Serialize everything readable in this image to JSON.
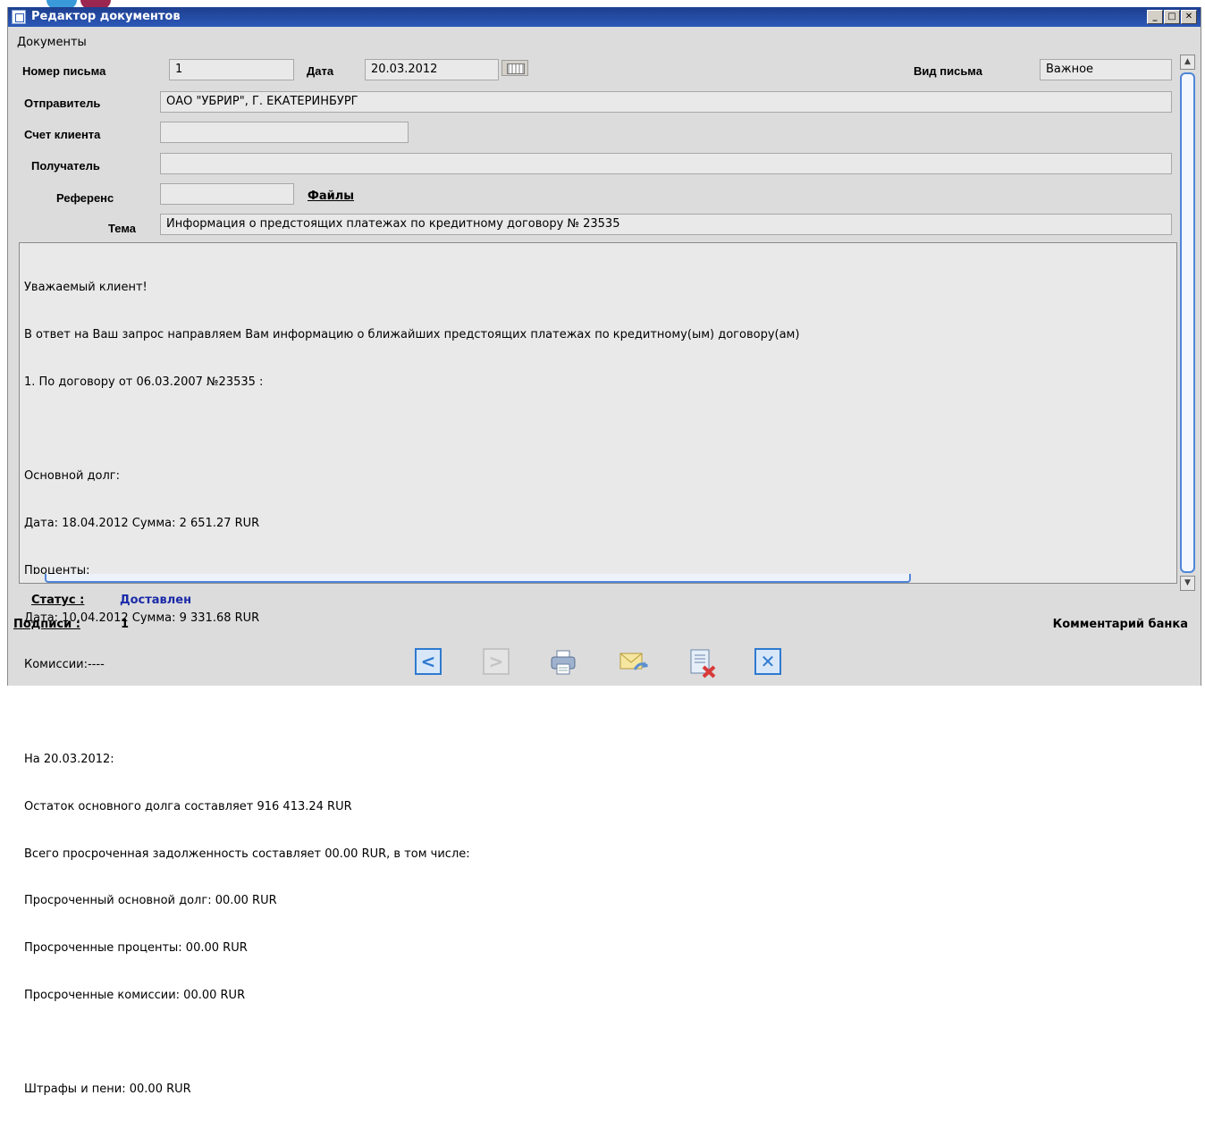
{
  "window": {
    "title": "Редактор документов",
    "controls": {
      "minimize": "_",
      "maximize": "□",
      "close": "✕"
    }
  },
  "menu": {
    "documents": "Документы"
  },
  "form": {
    "letter_number_label": "Номер письма",
    "letter_number": "1",
    "date_label": "Дата",
    "date": "20.03.2012",
    "letter_type_label": "Вид письма",
    "letter_type": "Важное",
    "sender_label": "Отправитель",
    "sender": "ОАО \"УБРИР\", Г. ЕКАТЕРИНБУРГ",
    "client_account_label": "Счет клиента",
    "client_account": "",
    "recipient_label": "Получатель",
    "recipient": "",
    "reference_label": "Референс",
    "reference": "",
    "files_link": "Файлы",
    "subject_label": "Тема",
    "subject": "Информация о предстоящих платежах по кредитному договору № 23535"
  },
  "body_lines": [
    "Уважаемый клиент!",
    "В ответ на Ваш запрос направляем Вам информацию о ближайших предстоящих платежах по кредитному(ым) договору(ам)",
    "1. По договору от 06.03.2007 №23535 :",
    "",
    "Основной долг:",
    "Дата: 18.04.2012 Сумма: 2 651.27 RUR",
    "Проценты:",
    "Дата: 10.04.2012 Сумма: 9 331.68 RUR",
    "Комиссии:----",
    "",
    "На 20.03.2012:",
    "Остаток основного долга составляет 916 413.24 RUR",
    "Всего просроченная задолженность составляет 00.00 RUR, в том числе:",
    "Просроченный основной долг: 00.00 RUR",
    "Просроченные проценты: 00.00 RUR",
    "Просроченные комиссии: 00.00 RUR",
    "",
    "Штрафы и пени: 00.00 RUR"
  ],
  "footer": {
    "status_label": "Статус :",
    "status_value": "Доставлен",
    "signatures_label": "Подписи :",
    "signatures_value": "1",
    "bank_comment": "Комментарий банка"
  },
  "toolbar": {
    "prev_icon": "chevron-left-icon",
    "next_icon": "chevron-right-icon",
    "print_icon": "printer-icon",
    "mail_icon": "mail-reply-icon",
    "delete_doc_icon": "delete-document-icon",
    "close_icon": "close-icon"
  },
  "colors": {
    "titlebar": "#1d3f8f",
    "accent": "#2f7ad0",
    "status": "#1a2aa8"
  }
}
